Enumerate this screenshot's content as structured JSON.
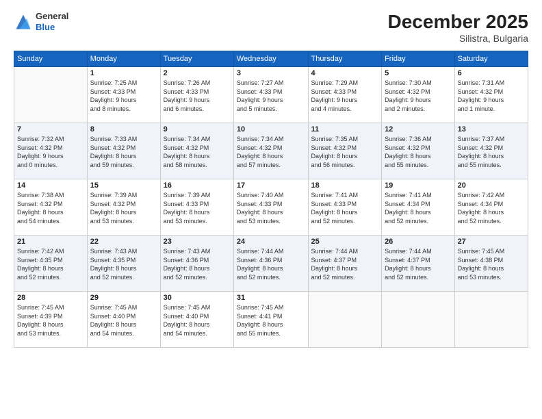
{
  "logo": {
    "general": "General",
    "blue": "Blue"
  },
  "header": {
    "month_year": "December 2025",
    "location": "Silistra, Bulgaria"
  },
  "days_of_week": [
    "Sunday",
    "Monday",
    "Tuesday",
    "Wednesday",
    "Thursday",
    "Friday",
    "Saturday"
  ],
  "weeks": [
    [
      {
        "day": "",
        "info": ""
      },
      {
        "day": "1",
        "info": "Sunrise: 7:25 AM\nSunset: 4:33 PM\nDaylight: 9 hours\nand 8 minutes."
      },
      {
        "day": "2",
        "info": "Sunrise: 7:26 AM\nSunset: 4:33 PM\nDaylight: 9 hours\nand 6 minutes."
      },
      {
        "day": "3",
        "info": "Sunrise: 7:27 AM\nSunset: 4:33 PM\nDaylight: 9 hours\nand 5 minutes."
      },
      {
        "day": "4",
        "info": "Sunrise: 7:29 AM\nSunset: 4:33 PM\nDaylight: 9 hours\nand 4 minutes."
      },
      {
        "day": "5",
        "info": "Sunrise: 7:30 AM\nSunset: 4:32 PM\nDaylight: 9 hours\nand 2 minutes."
      },
      {
        "day": "6",
        "info": "Sunrise: 7:31 AM\nSunset: 4:32 PM\nDaylight: 9 hours\nand 1 minute."
      }
    ],
    [
      {
        "day": "7",
        "info": "Sunrise: 7:32 AM\nSunset: 4:32 PM\nDaylight: 9 hours\nand 0 minutes."
      },
      {
        "day": "8",
        "info": "Sunrise: 7:33 AM\nSunset: 4:32 PM\nDaylight: 8 hours\nand 59 minutes."
      },
      {
        "day": "9",
        "info": "Sunrise: 7:34 AM\nSunset: 4:32 PM\nDaylight: 8 hours\nand 58 minutes."
      },
      {
        "day": "10",
        "info": "Sunrise: 7:34 AM\nSunset: 4:32 PM\nDaylight: 8 hours\nand 57 minutes."
      },
      {
        "day": "11",
        "info": "Sunrise: 7:35 AM\nSunset: 4:32 PM\nDaylight: 8 hours\nand 56 minutes."
      },
      {
        "day": "12",
        "info": "Sunrise: 7:36 AM\nSunset: 4:32 PM\nDaylight: 8 hours\nand 55 minutes."
      },
      {
        "day": "13",
        "info": "Sunrise: 7:37 AM\nSunset: 4:32 PM\nDaylight: 8 hours\nand 55 minutes."
      }
    ],
    [
      {
        "day": "14",
        "info": "Sunrise: 7:38 AM\nSunset: 4:32 PM\nDaylight: 8 hours\nand 54 minutes."
      },
      {
        "day": "15",
        "info": "Sunrise: 7:39 AM\nSunset: 4:32 PM\nDaylight: 8 hours\nand 53 minutes."
      },
      {
        "day": "16",
        "info": "Sunrise: 7:39 AM\nSunset: 4:33 PM\nDaylight: 8 hours\nand 53 minutes."
      },
      {
        "day": "17",
        "info": "Sunrise: 7:40 AM\nSunset: 4:33 PM\nDaylight: 8 hours\nand 53 minutes."
      },
      {
        "day": "18",
        "info": "Sunrise: 7:41 AM\nSunset: 4:33 PM\nDaylight: 8 hours\nand 52 minutes."
      },
      {
        "day": "19",
        "info": "Sunrise: 7:41 AM\nSunset: 4:34 PM\nDaylight: 8 hours\nand 52 minutes."
      },
      {
        "day": "20",
        "info": "Sunrise: 7:42 AM\nSunset: 4:34 PM\nDaylight: 8 hours\nand 52 minutes."
      }
    ],
    [
      {
        "day": "21",
        "info": "Sunrise: 7:42 AM\nSunset: 4:35 PM\nDaylight: 8 hours\nand 52 minutes."
      },
      {
        "day": "22",
        "info": "Sunrise: 7:43 AM\nSunset: 4:35 PM\nDaylight: 8 hours\nand 52 minutes."
      },
      {
        "day": "23",
        "info": "Sunrise: 7:43 AM\nSunset: 4:36 PM\nDaylight: 8 hours\nand 52 minutes."
      },
      {
        "day": "24",
        "info": "Sunrise: 7:44 AM\nSunset: 4:36 PM\nDaylight: 8 hours\nand 52 minutes."
      },
      {
        "day": "25",
        "info": "Sunrise: 7:44 AM\nSunset: 4:37 PM\nDaylight: 8 hours\nand 52 minutes."
      },
      {
        "day": "26",
        "info": "Sunrise: 7:44 AM\nSunset: 4:37 PM\nDaylight: 8 hours\nand 52 minutes."
      },
      {
        "day": "27",
        "info": "Sunrise: 7:45 AM\nSunset: 4:38 PM\nDaylight: 8 hours\nand 53 minutes."
      }
    ],
    [
      {
        "day": "28",
        "info": "Sunrise: 7:45 AM\nSunset: 4:39 PM\nDaylight: 8 hours\nand 53 minutes."
      },
      {
        "day": "29",
        "info": "Sunrise: 7:45 AM\nSunset: 4:40 PM\nDaylight: 8 hours\nand 54 minutes."
      },
      {
        "day": "30",
        "info": "Sunrise: 7:45 AM\nSunset: 4:40 PM\nDaylight: 8 hours\nand 54 minutes."
      },
      {
        "day": "31",
        "info": "Sunrise: 7:45 AM\nSunset: 4:41 PM\nDaylight: 8 hours\nand 55 minutes."
      },
      {
        "day": "",
        "info": ""
      },
      {
        "day": "",
        "info": ""
      },
      {
        "day": "",
        "info": ""
      }
    ]
  ]
}
